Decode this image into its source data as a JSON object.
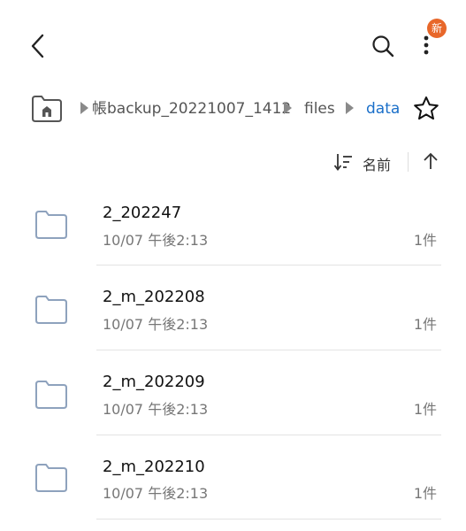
{
  "topbar": {
    "back_icon": "chevron-left-icon",
    "search_icon": "search-icon",
    "more_icon": "more-vertical-icon",
    "new_badge": "新"
  },
  "breadcrumb": {
    "home_icon": "home-folder-icon",
    "items": [
      {
        "label": "帳backup_20221007_1412"
      },
      {
        "label": "files"
      },
      {
        "label": "data"
      }
    ],
    "star_icon": "star-icon"
  },
  "sort": {
    "label": "名前",
    "sort_icon": "sort-icon",
    "direction_icon": "arrow-up-icon"
  },
  "colors": {
    "accent": "#1a6fc9",
    "badge": "#e8672a",
    "folder_stroke": "#8ea2bd"
  },
  "files": [
    {
      "name": "2_202247",
      "date": "10/07 午後2:13",
      "count": "1件"
    },
    {
      "name": "2_m_202208",
      "date": "10/07 午後2:13",
      "count": "1件"
    },
    {
      "name": "2_m_202209",
      "date": "10/07 午後2:13",
      "count": "1件"
    },
    {
      "name": "2_m_202210",
      "date": "10/07 午後2:13",
      "count": "1件"
    }
  ]
}
